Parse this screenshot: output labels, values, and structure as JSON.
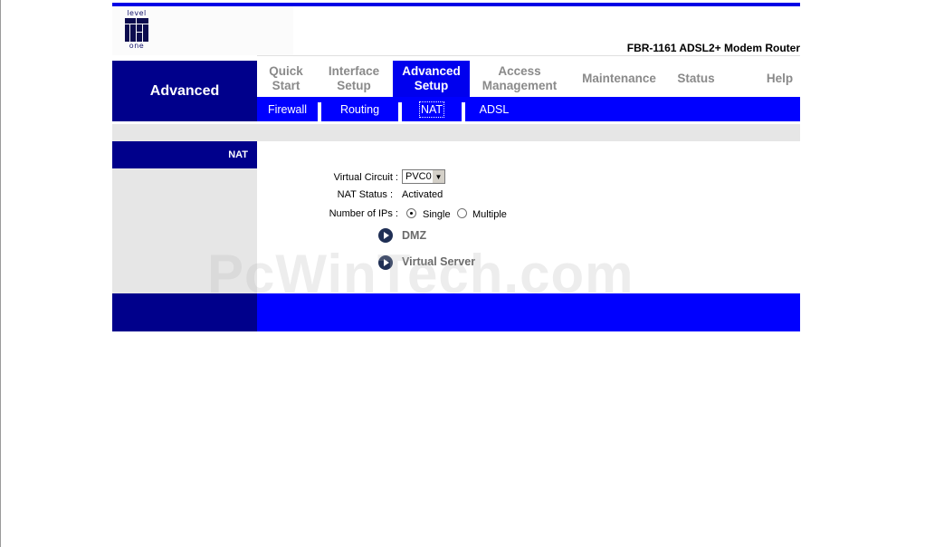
{
  "brand": {
    "logo_top": "level",
    "logo_bottom": "one"
  },
  "header": {
    "product": "FBR-1161 ADSL2+ Modem Router"
  },
  "section": {
    "title": "Advanced"
  },
  "nav": {
    "items": [
      {
        "line1": "Quick",
        "line2": "Start"
      },
      {
        "line1": "Interface",
        "line2": "Setup"
      },
      {
        "line1": "Advanced",
        "line2": "Setup"
      },
      {
        "line1": "Access",
        "line2": "Management"
      },
      {
        "line1": "Maintenance",
        "line2": ""
      },
      {
        "line1": "Status",
        "line2": ""
      },
      {
        "line1": "Help",
        "line2": ""
      }
    ],
    "active": "Advanced Setup"
  },
  "subnav": {
    "items": [
      {
        "label": "Firewall"
      },
      {
        "label": "Routing"
      },
      {
        "label": "NAT"
      },
      {
        "label": "ADSL"
      }
    ],
    "active": "NAT"
  },
  "panel": {
    "title": "NAT"
  },
  "form": {
    "virtual_circuit_label": "Virtual Circuit :",
    "virtual_circuit_value": "PVC0",
    "nat_status_label": "NAT Status :",
    "nat_status_value": "Activated",
    "num_ips_label": "Number of IPs :",
    "num_ips_options": [
      "Single",
      "Multiple"
    ],
    "num_ips_selected": "Single"
  },
  "links": {
    "dmz": "DMZ",
    "virtual_server": "Virtual Server"
  },
  "watermark": "PcWinTech.com",
  "colors": {
    "navy": "#00008b",
    "blue": "#0000ff",
    "active_tab": "#0000ee",
    "gray": "#e6e6e6"
  }
}
